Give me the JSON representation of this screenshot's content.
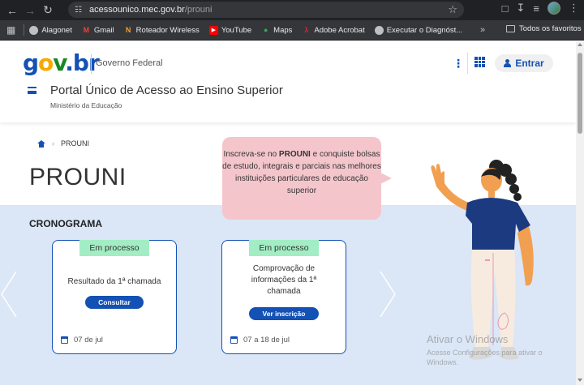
{
  "browser": {
    "url_host": "acessounico.mec.gov.br",
    "url_path": "/prouni",
    "bookmarks": [
      {
        "label": "Alagonet",
        "icon": "globe-icon"
      },
      {
        "label": "Gmail",
        "icon": "gmail-icon"
      },
      {
        "label": "Roteador Wireless",
        "icon": "router-icon"
      },
      {
        "label": "YouTube",
        "icon": "youtube-icon"
      },
      {
        "label": "Maps",
        "icon": "maps-icon"
      },
      {
        "label": "Adobe Acrobat",
        "icon": "acrobat-icon"
      },
      {
        "label": "Executar o Diagnóst...",
        "icon": "globe-icon"
      }
    ],
    "more_bookmarks": "»",
    "all_bookmarks": "Todos os favoritos"
  },
  "header": {
    "logo": {
      "g": "g",
      "o": "o",
      "v": "v",
      "dot": ".",
      "br": "br"
    },
    "gov_label": "Governo Federal",
    "login_label": "Entrar",
    "portal_title": "Portal Único de Acesso ao Ensino Superior",
    "portal_subtitle": "Ministério da Educação"
  },
  "breadcrumb": {
    "current": "PROUNI"
  },
  "page_title": "PROUNI",
  "bubble": {
    "pre": "Inscreva-se no ",
    "bold": "PROUNI",
    "post": " e conquiste bolsas de estudo, integrais e parciais nas melhores instituições particulares de educação superior"
  },
  "cronograma": {
    "title": "CRONOGRAMA",
    "cards": [
      {
        "status": "Em processo",
        "text": "Resultado da 1ª chamada",
        "button": "Consultar",
        "date": "07 de jul"
      },
      {
        "status": "Em processo",
        "text": "Comprovação de informações da 1ª chamada",
        "button": "Ver inscrição",
        "date": "07 a 18 de jul"
      }
    ]
  },
  "watermark": {
    "title": "Ativar o Windows",
    "line1": "Acesse Configurações para ativar o",
    "line2": "Windows."
  },
  "colors": {
    "primary": "#1351b4",
    "band": "#dbe6f6",
    "tag": "#a3edc4",
    "bubble": "#f4c6cc"
  }
}
